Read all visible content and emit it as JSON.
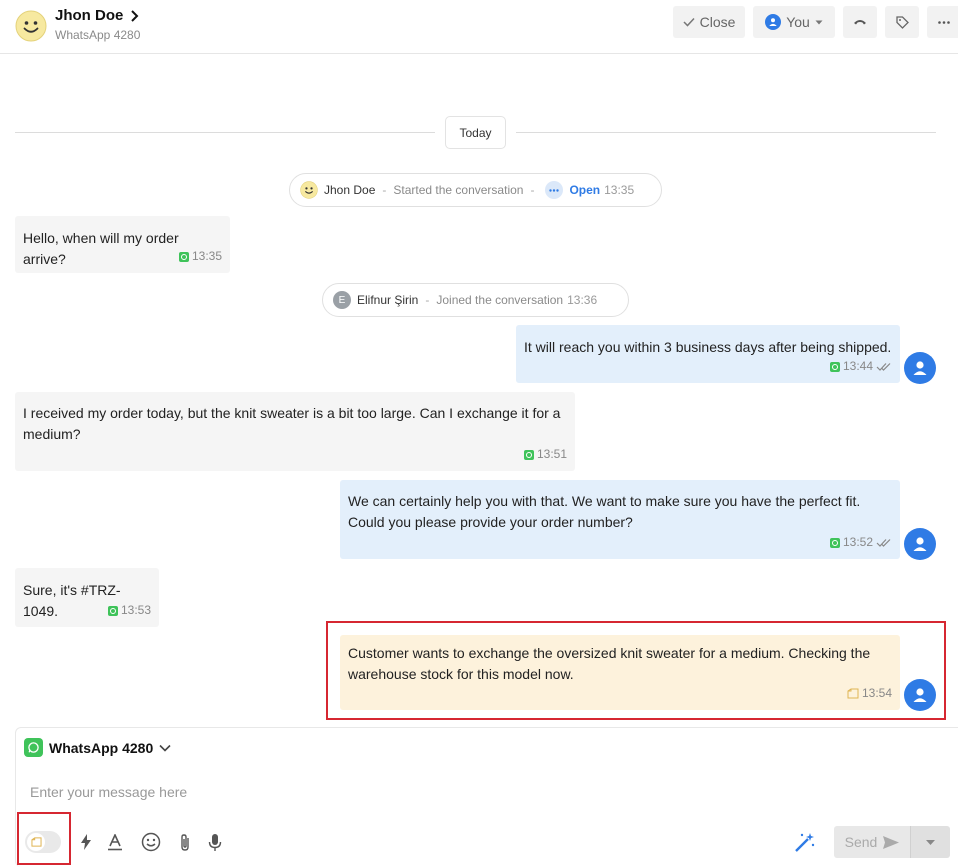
{
  "header": {
    "contact_name": "Jhon Doe",
    "channel": "WhatsApp 4280",
    "close_label": "Close",
    "assignee_label": "You"
  },
  "timeline": {
    "date_label": "Today",
    "events": [
      {
        "name": "Jhon Doe",
        "action": "Started the conversation",
        "status": "Open",
        "time": "13:35"
      },
      {
        "avatar_letter": "E",
        "name": "Elifnur Şirin",
        "action": "Joined the conversation",
        "time": "13:36"
      }
    ]
  },
  "messages": [
    {
      "direction": "in",
      "text": "Hello, when will my order arrive?",
      "time": "13:35"
    },
    {
      "direction": "out",
      "text": "It will reach you within 3 business days after being shipped.",
      "time": "13:44"
    },
    {
      "direction": "in",
      "text": "I received my order today, but the knit sweater is a bit too large. Can I exchange it for a medium?",
      "time": "13:51"
    },
    {
      "direction": "out",
      "text": "We can certainly help you with that. We want to make sure you have the perfect fit. Could you please provide your order number?",
      "time": "13:52"
    },
    {
      "direction": "in",
      "text": "Sure, it's #TRZ-1049.",
      "time": "13:53"
    },
    {
      "direction": "note",
      "text": "Customer wants to exchange the oversized knit sweater for a medium. Checking the warehouse stock for this model now.",
      "time": "13:54"
    }
  ],
  "composer": {
    "channel_label": "WhatsApp 4280",
    "placeholder": "Enter your message here",
    "send_label": "Send"
  },
  "colors": {
    "accent": "#2f7be5",
    "whatsapp": "#3fc35a",
    "note_bg": "#fdf2dc",
    "highlight": "#d62731"
  }
}
